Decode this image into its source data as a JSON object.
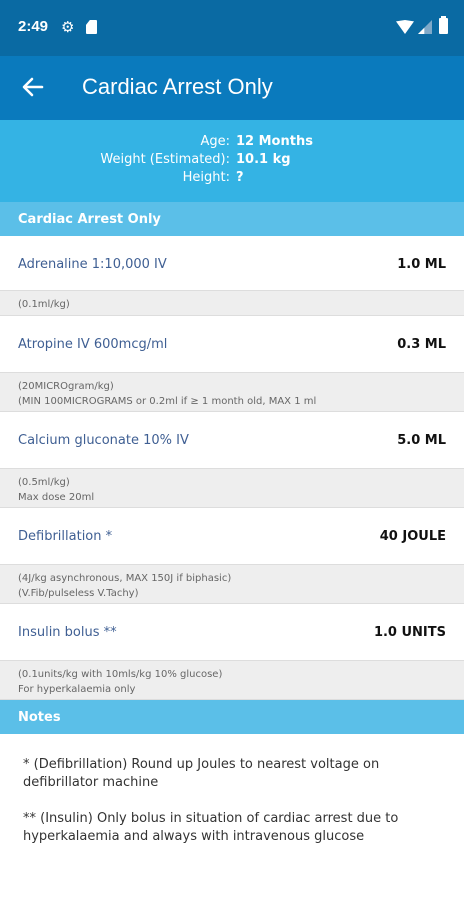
{
  "status": {
    "time": "2:49"
  },
  "appbar": {
    "title": "Cardiac Arrest Only"
  },
  "patient": {
    "age_label": "Age:",
    "age_value": "12 Months",
    "weight_label": "Weight (Estimated):",
    "weight_value": "10.1 kg",
    "height_label": "Height:",
    "height_value": "?"
  },
  "section": {
    "title": "Cardiac Arrest Only"
  },
  "drugs": [
    {
      "name": "Adrenaline 1:10,000 IV",
      "dose": "1.0 ML",
      "notes": [
        "(0.1ml/kg)"
      ]
    },
    {
      "name": "Atropine IV 600mcg/ml",
      "dose": "0.3 ML",
      "notes": [
        "(20MICROgram/kg)",
        "(MIN 100MICROGRAMS or 0.2ml if ≥ 1 month old, MAX 1 ml"
      ]
    },
    {
      "name": "Calcium gluconate 10% IV",
      "dose": "5.0 ML",
      "notes": [
        "(0.5ml/kg)",
        "Max dose 20ml"
      ]
    },
    {
      "name": "Defibrillation *",
      "dose": "40 JOULE",
      "notes": [
        "(4J/kg asynchronous, MAX 150J if biphasic)",
        "(V.Fib/pulseless V.Tachy)"
      ]
    },
    {
      "name": "Insulin bolus **",
      "dose": "1.0 UNITS",
      "notes": [
        "(0.1units/kg with 10mls/kg 10% glucose)",
        "For hyperkalaemia only"
      ]
    }
  ],
  "notes_section": {
    "title": "Notes",
    "items": [
      "* (Defibrillation) Round up Joules to nearest voltage on defibrillator machine",
      "** (Insulin) Only bolus in situation of cardiac arrest due to hyperkalaemia and always with intravenous glucose"
    ]
  },
  "colors": {
    "statusbar": "#0a6aa3",
    "appbar": "#0a7abd",
    "patient_bg": "#34b3e4",
    "section_bg": "#5bbfe8",
    "drug_name": "#3f5f93"
  }
}
